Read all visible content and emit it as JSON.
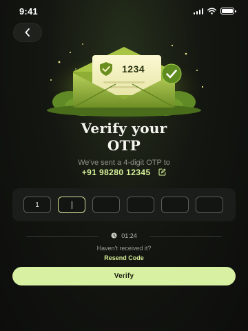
{
  "status_bar": {
    "time": "9:41"
  },
  "hero": {
    "otp_card_code": "1234"
  },
  "title": {
    "line1": "Verify your",
    "line2": "OTP"
  },
  "subtitle": "We've sent a 4-digit OTP to",
  "phone": "+91 98280 12345",
  "otp": {
    "digits": [
      "1",
      "",
      "",
      "",
      "",
      ""
    ],
    "active_index": 1
  },
  "timer": "01:24",
  "not_received": "Haven't received it?",
  "resend_label": "Resend Code",
  "verify_label": "Verify",
  "colors": {
    "accent": "#d7f0a2",
    "background": "#121410",
    "card": "#1b1d1a"
  },
  "icons": {
    "back": "chevron-left-icon",
    "edit": "edit-icon",
    "clock": "clock-icon",
    "shield": "shield-check-icon",
    "check": "check-badge-icon"
  }
}
